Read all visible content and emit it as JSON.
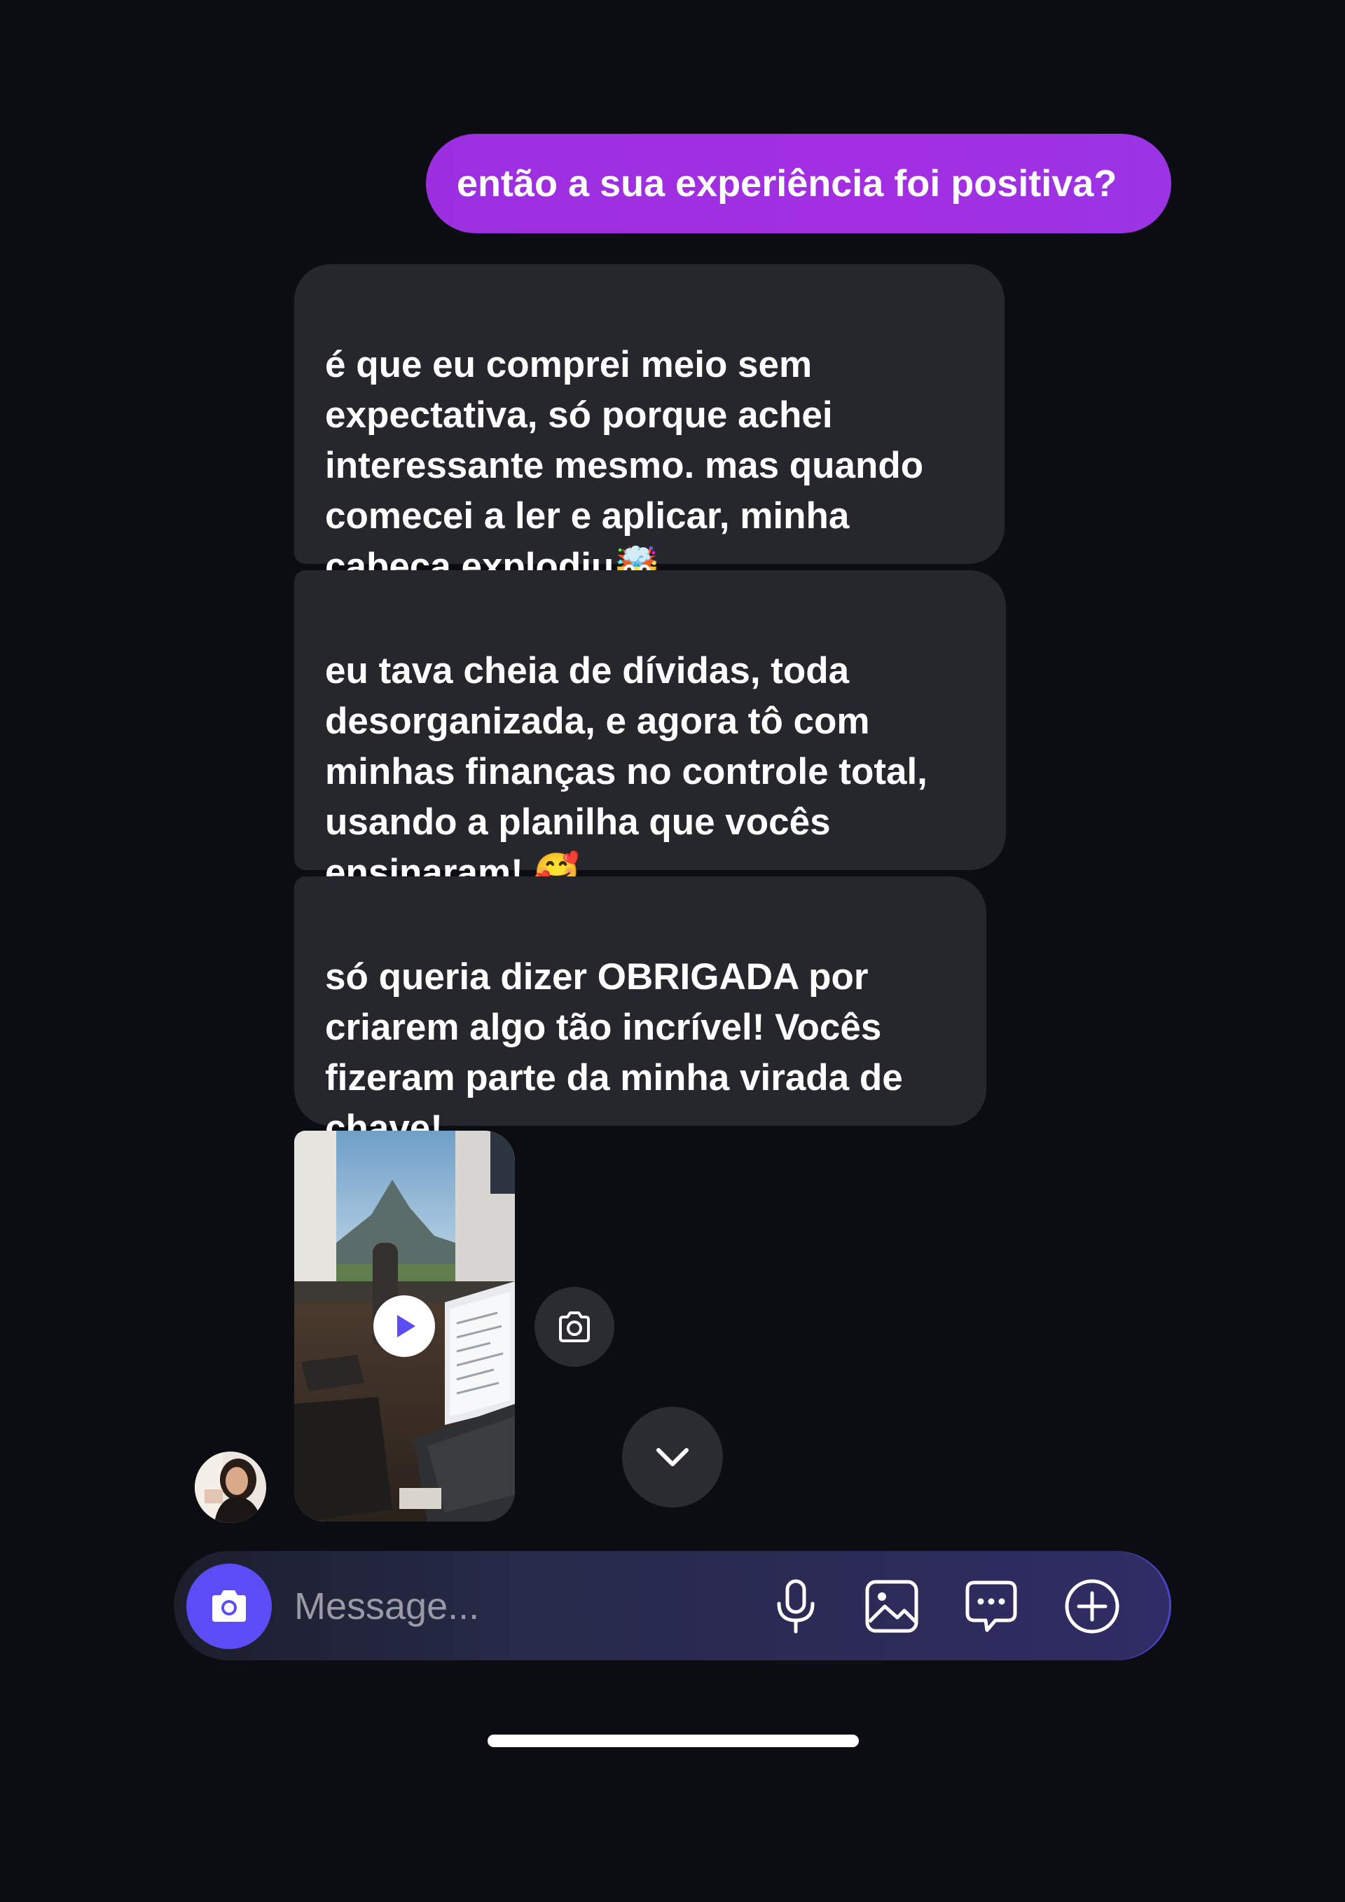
{
  "thread": {
    "sent": [
      {
        "text": "então a sua experiência foi positiva?"
      }
    ],
    "received": [
      {
        "text": "é que eu comprei meio sem\nexpectativa, só porque achei\ninteressante mesmo. mas quando\ncomecei a ler e aplicar, minha\ncabeça explodiu🤯"
      },
      {
        "text": "eu tava cheia de dívidas, toda\ndesorganizada, e agora tô com\nminhas finanças no controle total,\nusando a planilha que vocês\nensinaram! 🥰"
      },
      {
        "text": "só queria dizer OBRIGADA por\ncriarem algo tão incrível! Vocês\nfizeram parte da minha virada de\nchave!"
      }
    ],
    "attachment": {
      "type": "video",
      "icon": "play-icon"
    }
  },
  "composer": {
    "placeholder": "Message...",
    "icons": [
      "camera-icon",
      "microphone-icon",
      "gallery-icon",
      "sticker-icon",
      "plus-icon"
    ]
  },
  "colors": {
    "background": "#0b0d12",
    "sent_bubble": "#a32fe2",
    "received_bubble": "#26272c",
    "accent": "#5b4cf5"
  }
}
